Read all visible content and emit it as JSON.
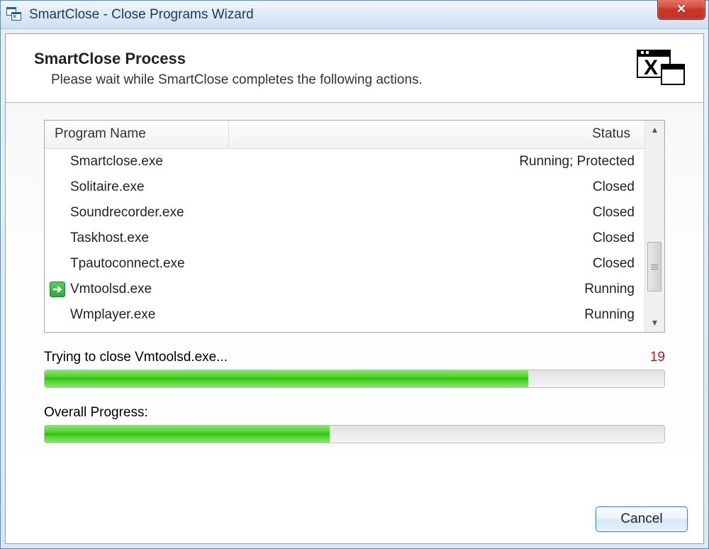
{
  "window": {
    "title": "SmartClose - Close Programs Wizard"
  },
  "header": {
    "title": "SmartClose Process",
    "subtitle": "Please wait while SmartClose completes the following actions."
  },
  "list": {
    "col_program": "Program Name",
    "col_status": "Status",
    "rows": [
      {
        "name": "Smartclose.exe",
        "status": "Running; Protected",
        "current": false
      },
      {
        "name": "Solitaire.exe",
        "status": "Closed",
        "current": false
      },
      {
        "name": "Soundrecorder.exe",
        "status": "Closed",
        "current": false
      },
      {
        "name": "Taskhost.exe",
        "status": "Closed",
        "current": false
      },
      {
        "name": "Tpautoconnect.exe",
        "status": "Closed",
        "current": false
      },
      {
        "name": "Vmtoolsd.exe",
        "status": "Running",
        "current": true
      },
      {
        "name": "Wmplayer.exe",
        "status": "Running",
        "current": false
      }
    ]
  },
  "progress1": {
    "label": "Trying to close Vmtoolsd.exe...",
    "count": "19",
    "percent": 78
  },
  "progress2": {
    "label": "Overall Progress:",
    "percent": 46
  },
  "footer": {
    "cancel": "Cancel"
  }
}
